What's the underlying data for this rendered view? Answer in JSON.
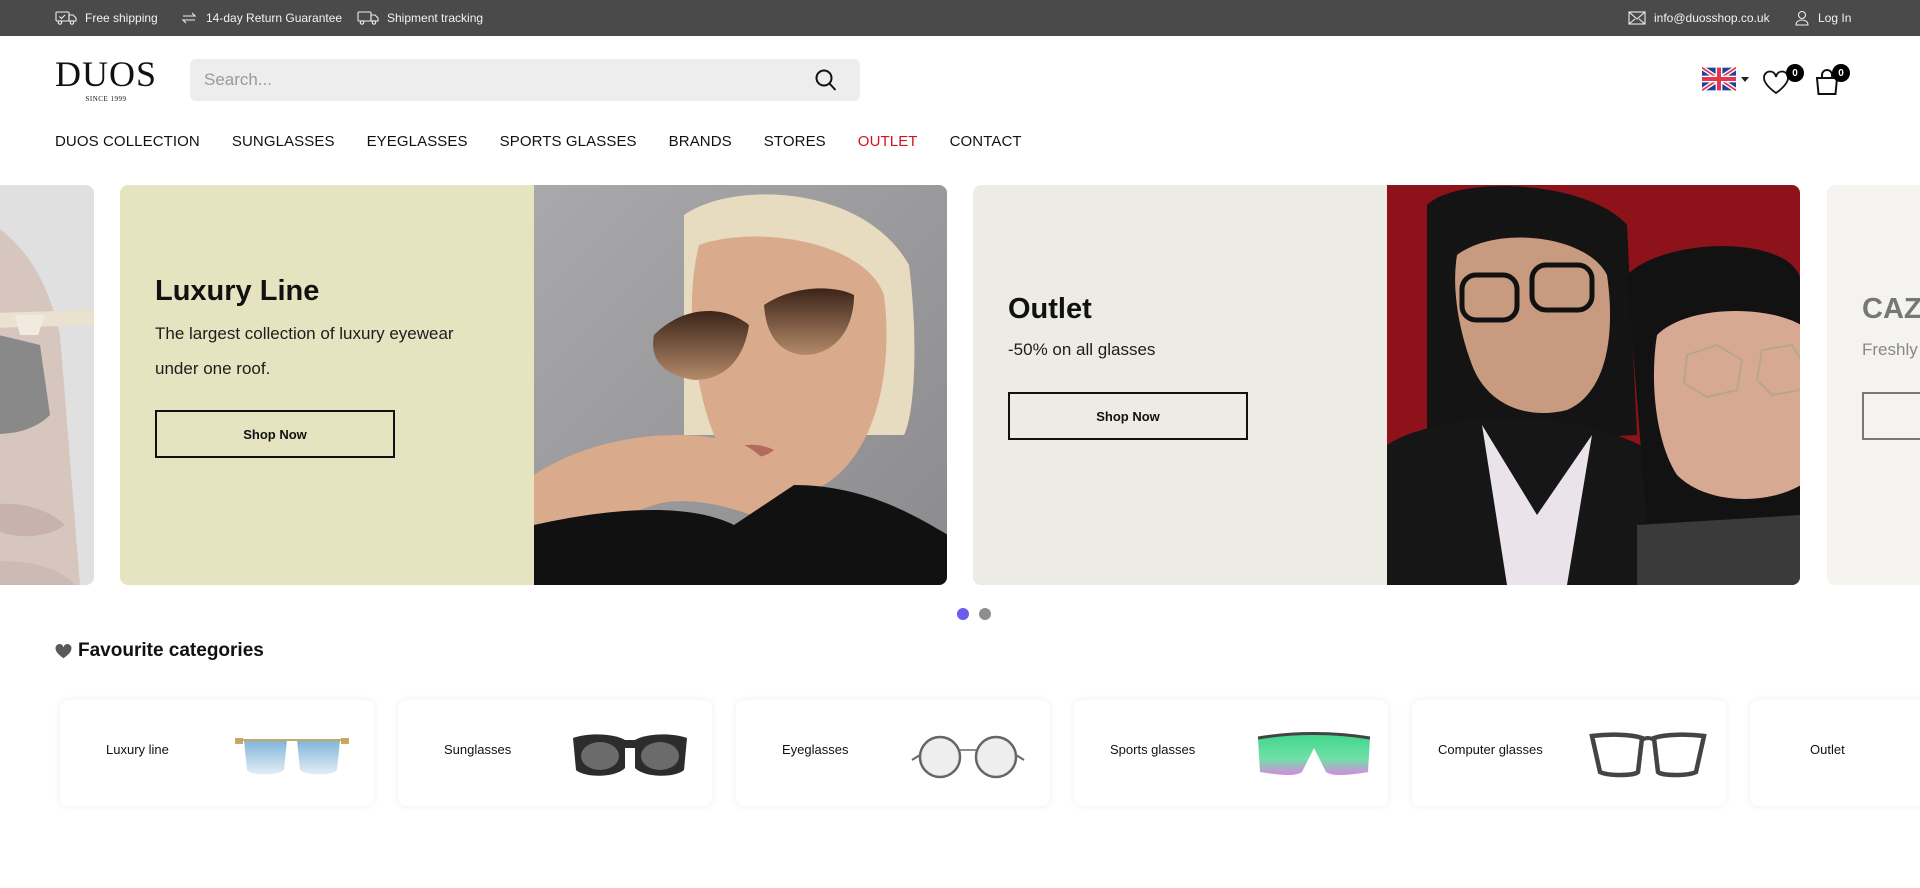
{
  "topbar": {
    "left": [
      {
        "icon": "delivery-truck-check-icon",
        "label": "Free shipping"
      },
      {
        "icon": "return-arrows-icon",
        "label": "14-day Return Guarantee"
      },
      {
        "icon": "shipment-truck-icon",
        "label": "Shipment tracking"
      }
    ],
    "email": {
      "icon": "envelope-icon",
      "label": "info@duosshop.co.uk"
    },
    "login": {
      "icon": "user-icon",
      "label": "Log In"
    }
  },
  "header": {
    "logo": {
      "wordmark": "DUOS",
      "tagline": "SINCE 1999"
    },
    "search": {
      "placeholder": "Search...",
      "value": ""
    },
    "language": {
      "selected": "English (UK)",
      "icon": "uk-flag-icon"
    },
    "wishlist_count": "0",
    "cart_count": "0"
  },
  "nav": {
    "items": [
      {
        "label": "DUOS COLLECTION",
        "highlight": false
      },
      {
        "label": "SUNGLASSES",
        "highlight": false
      },
      {
        "label": "EYEGLASSES",
        "highlight": false
      },
      {
        "label": "SPORTS GLASSES",
        "highlight": false
      },
      {
        "label": "BRANDS",
        "highlight": false
      },
      {
        "label": "STORES",
        "highlight": false
      },
      {
        "label": "OUTLET",
        "highlight": true
      },
      {
        "label": "CONTACT",
        "highlight": false
      }
    ],
    "highlight_color": "#d0161c"
  },
  "slider": {
    "slides": [
      {
        "title": "Luxury Line",
        "subtitle": "The largest collection of luxury eyewear under one roof.",
        "button": "Shop Now",
        "bg": "#e6e4c0",
        "image": "woman-aviator-sunglasses-photo"
      },
      {
        "title": "Outlet",
        "subtitle": "-50% on all glasses",
        "button": "Shop Now",
        "bg": "#ecebe4",
        "image": "couple-eyeglasses-red-background-photo"
      },
      {
        "title": "CAZA",
        "subtitle": "Freshly",
        "button": "",
        "bg": "#f4f3f0",
        "image": ""
      }
    ],
    "previous_slide_image": "man-sunglasses-closeup-photo",
    "dots": {
      "count": 2,
      "active": 0
    },
    "dot_active_color": "#6b5cf0"
  },
  "favourites": {
    "title": "Favourite categories",
    "icon": "heart-icon",
    "categories": [
      {
        "label": "Luxury line",
        "image": "blue-rimless-sunglasses"
      },
      {
        "label": "Sunglasses",
        "image": "black-chunky-sunglasses"
      },
      {
        "label": "Eyeglasses",
        "image": "round-metal-eyeglasses"
      },
      {
        "label": "Sports glasses",
        "image": "green-shield-sports-glasses"
      },
      {
        "label": "Computer glasses",
        "image": "dark-square-eyeglasses"
      },
      {
        "label": "Outlet",
        "image": ""
      }
    ]
  }
}
